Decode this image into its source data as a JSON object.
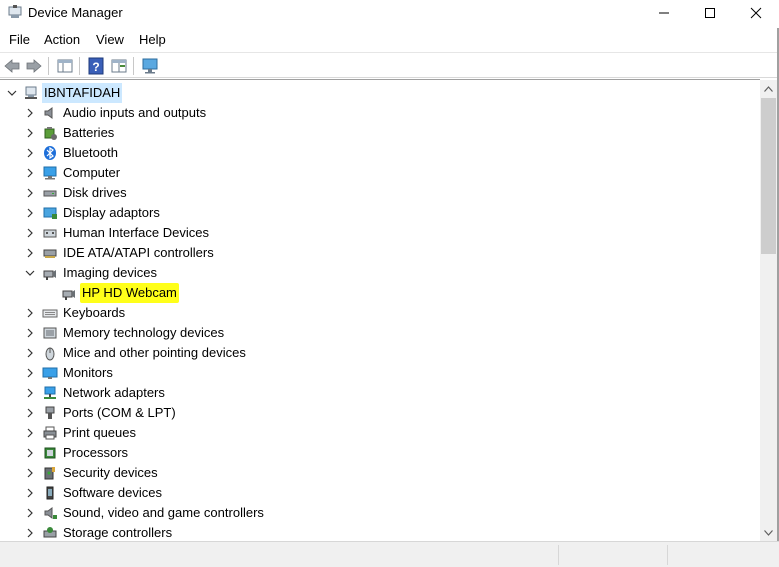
{
  "window": {
    "title": "Device Manager",
    "icon": "device-manager-icon"
  },
  "menu": [
    "File",
    "Action",
    "View",
    "Help"
  ],
  "toolbar": [
    "back-arrow-icon",
    "forward-arrow-icon",
    "properties-pane-icon",
    "help-icon",
    "details-pane-icon",
    "scan-hardware-icon"
  ],
  "tree": {
    "root": "IBNTAFIDAH",
    "categories": [
      {
        "label": "Audio inputs and outputs",
        "icon": "speaker-icon",
        "expanded": false
      },
      {
        "label": "Batteries",
        "icon": "battery-icon",
        "expanded": false
      },
      {
        "label": "Bluetooth",
        "icon": "bluetooth-icon",
        "expanded": false
      },
      {
        "label": "Computer",
        "icon": "computer-icon",
        "expanded": false
      },
      {
        "label": "Disk drives",
        "icon": "disk-drive-icon",
        "expanded": false
      },
      {
        "label": "Display adaptors",
        "icon": "display-adapter-icon",
        "expanded": false
      },
      {
        "label": "Human Interface Devices",
        "icon": "hid-icon",
        "expanded": false
      },
      {
        "label": "IDE ATA/ATAPI controllers",
        "icon": "ide-controller-icon",
        "expanded": false
      },
      {
        "label": "Imaging devices",
        "icon": "camera-icon",
        "expanded": true,
        "children": [
          "HP HD Webcam"
        ]
      },
      {
        "label": "Keyboards",
        "icon": "keyboard-icon",
        "expanded": false
      },
      {
        "label": "Memory technology devices",
        "icon": "memory-icon",
        "expanded": false
      },
      {
        "label": "Mice and other pointing devices",
        "icon": "mouse-icon",
        "expanded": false
      },
      {
        "label": "Monitors",
        "icon": "monitor-icon",
        "expanded": false
      },
      {
        "label": "Network adapters",
        "icon": "network-icon",
        "expanded": false
      },
      {
        "label": "Ports (COM & LPT)",
        "icon": "port-icon",
        "expanded": false
      },
      {
        "label": "Print queues",
        "icon": "printer-icon",
        "expanded": false
      },
      {
        "label": "Processors",
        "icon": "processor-icon",
        "expanded": false
      },
      {
        "label": "Security devices",
        "icon": "security-icon",
        "expanded": false
      },
      {
        "label": "Software devices",
        "icon": "software-device-icon",
        "expanded": false
      },
      {
        "label": "Sound, video and game controllers",
        "icon": "sound-icon",
        "expanded": false
      },
      {
        "label": "Storage controllers",
        "icon": "storage-icon",
        "expanded": false
      }
    ]
  },
  "colors": {
    "root_selection": "#cce8ff",
    "highlight": "#ffff1a",
    "accent_blue": "#2e86de"
  }
}
